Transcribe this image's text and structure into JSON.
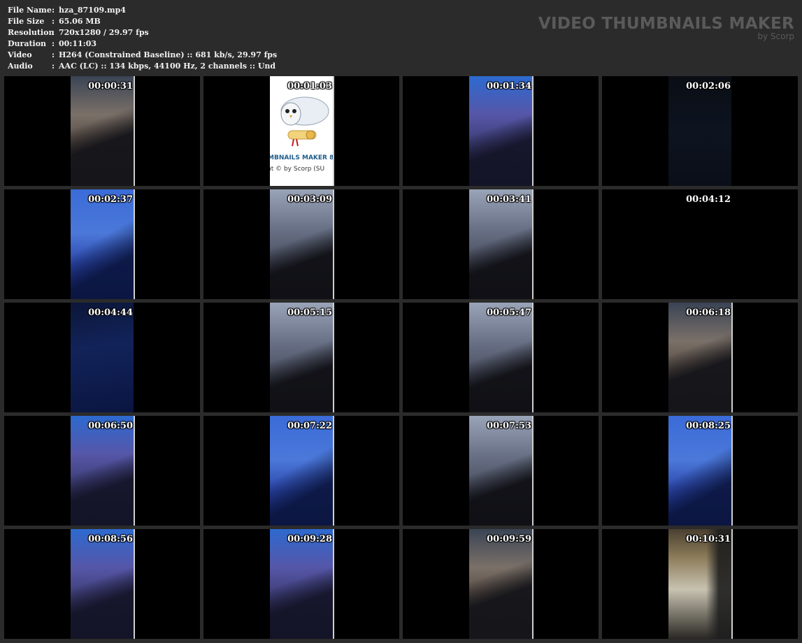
{
  "file_info": [
    {
      "label": "File Name",
      "sep": ":",
      "value": "hza_87109.mp4"
    },
    {
      "label": "File Size",
      "sep": ":",
      "value": "65.06 MB"
    },
    {
      "label": "Resolution",
      "sep": ":",
      "value": "720x1280 / 29.97 fps"
    },
    {
      "label": "Duration",
      "sep": ":",
      "value": "00:11:03"
    },
    {
      "label": "Video",
      "sep": ":",
      "value": "H264 (Constrained Baseline) :: 681 kb/s, 29.97 fps"
    },
    {
      "label": "Audio",
      "sep": ":",
      "value": "AAC (LC) :: 134 kbps, 44100 Hz, 2 channels :: Und"
    }
  ],
  "brand": {
    "title": "VIDEO THUMBNAILS MAKER",
    "subtitle": "by Scorp"
  },
  "logo_frame": {
    "text": "MBNAILS MAKER 8",
    "subtext": "nt © by Scorp (SU"
  },
  "thumbnails": [
    {
      "time": "00:00:31",
      "scene": "warm"
    },
    {
      "time": "00:01:03",
      "scene": "logo"
    },
    {
      "time": "00:01:34",
      "scene": "purple"
    },
    {
      "time": "00:02:06",
      "scene": "dark"
    },
    {
      "time": "00:02:37",
      "scene": "blue"
    },
    {
      "time": "00:03:09",
      "scene": "grey"
    },
    {
      "time": "00:03:41",
      "scene": "grey"
    },
    {
      "time": "00:04:12",
      "scene": "black"
    },
    {
      "time": "00:04:44",
      "scene": "darkblue"
    },
    {
      "time": "00:05:15",
      "scene": "grey"
    },
    {
      "time": "00:05:47",
      "scene": "grey"
    },
    {
      "time": "00:06:18",
      "scene": "warm"
    },
    {
      "time": "00:06:50",
      "scene": "purple"
    },
    {
      "time": "00:07:22",
      "scene": "blue"
    },
    {
      "time": "00:07:53",
      "scene": "grey"
    },
    {
      "time": "00:08:25",
      "scene": "blue"
    },
    {
      "time": "00:08:56",
      "scene": "purple"
    },
    {
      "time": "00:09:28",
      "scene": "purple"
    },
    {
      "time": "00:09:59",
      "scene": "warm"
    },
    {
      "time": "00:10:31",
      "scene": "room"
    }
  ]
}
